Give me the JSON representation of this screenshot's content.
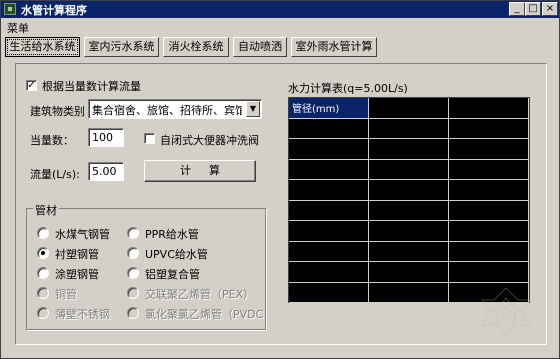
{
  "window": {
    "title": "水管计算程序",
    "min": "_",
    "max": "□",
    "close": "×"
  },
  "menu": {
    "label": "菜单"
  },
  "tabs": [
    {
      "label": "生活给水系统",
      "active": true
    },
    {
      "label": "室内污水系统",
      "active": false
    },
    {
      "label": "消火栓系统",
      "active": false
    },
    {
      "label": "自动喷洒",
      "active": false
    },
    {
      "label": "室外雨水管计算",
      "active": false
    }
  ],
  "form": {
    "calc_by_units_checked": true,
    "calc_by_units_label": "根据当量数计算流量",
    "building_type_label": "建筑物类别",
    "building_type_value": "集合宿舍、旅馆、招待所、宾馆",
    "equivalent_label": "当量数：",
    "equivalent_value": "100",
    "flush_valve_checked": false,
    "flush_valve_label": "自闭式大便器冲洗阀",
    "flow_label": "流量(L/s):",
    "flow_value": "5.00",
    "calc_button": "计算"
  },
  "material": {
    "title": "管材",
    "options": [
      {
        "label": "水煤气钢管",
        "checked": false,
        "disabled": false
      },
      {
        "label": "PPR给水管",
        "checked": false,
        "disabled": false
      },
      {
        "label": "衬塑钢管",
        "checked": true,
        "disabled": false
      },
      {
        "label": "UPVC给水管",
        "checked": false,
        "disabled": false
      },
      {
        "label": "涂塑钢管",
        "checked": false,
        "disabled": false
      },
      {
        "label": "铝塑复合管",
        "checked": false,
        "disabled": false
      },
      {
        "label": "铜管",
        "checked": false,
        "disabled": true
      },
      {
        "label": "交联聚乙烯管（PEX）",
        "checked": false,
        "disabled": true
      },
      {
        "label": "薄壁不锈钢",
        "checked": false,
        "disabled": true
      },
      {
        "label": "氯化聚氯乙烯管（PVDC",
        "checked": false,
        "disabled": true
      }
    ]
  },
  "table": {
    "title": "水力计算表(q=5.00L/s)",
    "header": "管径(mm)"
  }
}
